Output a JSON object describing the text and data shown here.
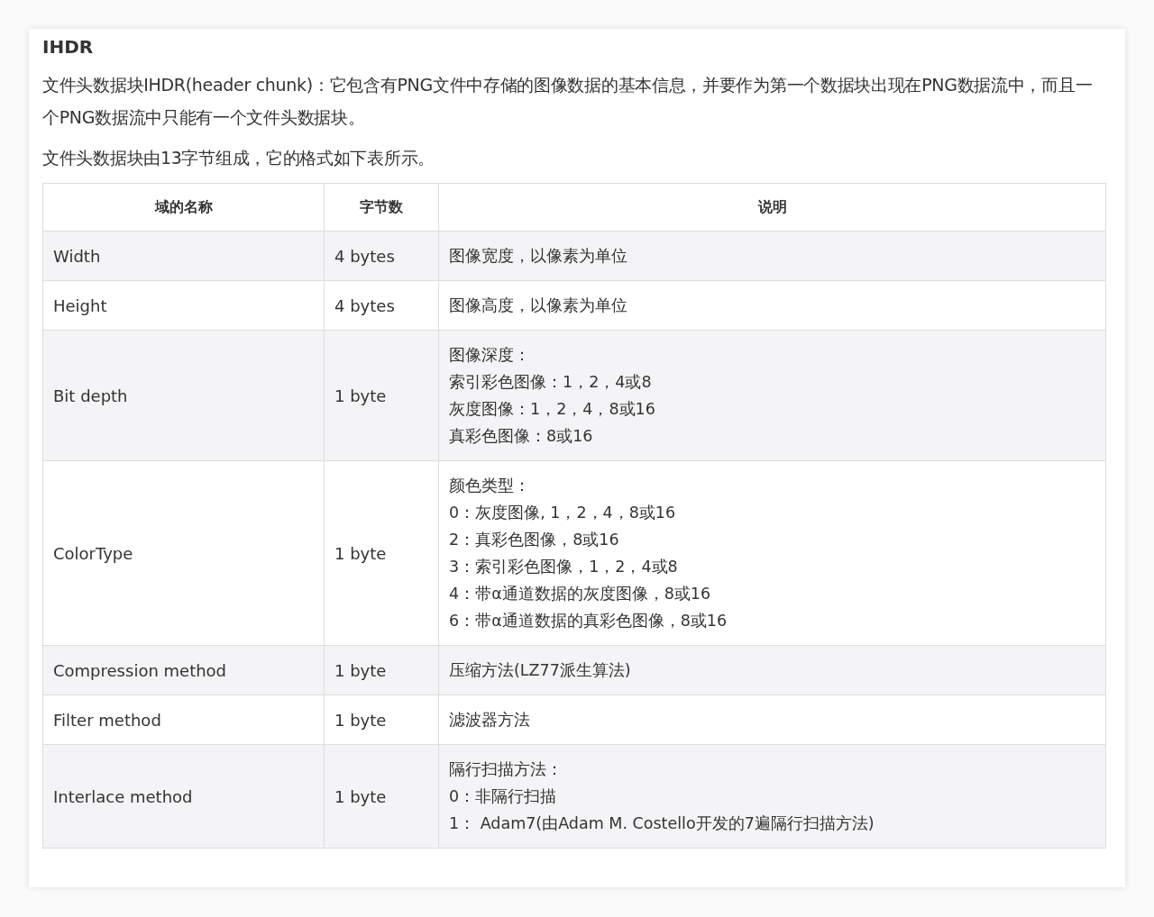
{
  "heading": "IHDR",
  "paragraphs": [
    "文件头数据块IHDR(header chunk)：它包含有PNG文件中存储的图像数据的基本信息，并要作为第一个数据块出现在PNG数据流中，而且一个PNG数据流中只能有一个文件头数据块。",
    "文件头数据块由13字节组成，它的格式如下表所示。"
  ],
  "table": {
    "columns": [
      "域的名称",
      "字节数",
      "说明"
    ],
    "rows": [
      {
        "name": "Width",
        "size": "4 bytes",
        "description": [
          "图像宽度，以像素为单位"
        ]
      },
      {
        "name": "Height",
        "size": "4 bytes",
        "description": [
          "图像高度，以像素为单位"
        ]
      },
      {
        "name": "Bit depth",
        "size": "1 byte",
        "description": [
          "图像深度：",
          "索引彩色图像：1，2，4或8",
          "灰度图像：1，2，4，8或16",
          "真彩色图像：8或16"
        ]
      },
      {
        "name": "ColorType",
        "size": "1 byte",
        "description": [
          "颜色类型：",
          "0：灰度图像, 1，2，4，8或16",
          "2：真彩色图像，8或16",
          "3：索引彩色图像，1，2，4或8",
          "4：带α通道数据的灰度图像，8或16",
          "6：带α通道数据的真彩色图像，8或16"
        ]
      },
      {
        "name": "Compression method",
        "size": "1 byte",
        "description": [
          "压缩方法(LZ77派生算法)"
        ]
      },
      {
        "name": "Filter method",
        "size": "1 byte",
        "description": [
          "滤波器方法"
        ]
      },
      {
        "name": "Interlace method",
        "size": "1 byte",
        "description": [
          "隔行扫描方法：",
          "0：非隔行扫描",
          "1： Adam7(由Adam M. Costello开发的7遍隔行扫描方法)"
        ]
      }
    ]
  }
}
